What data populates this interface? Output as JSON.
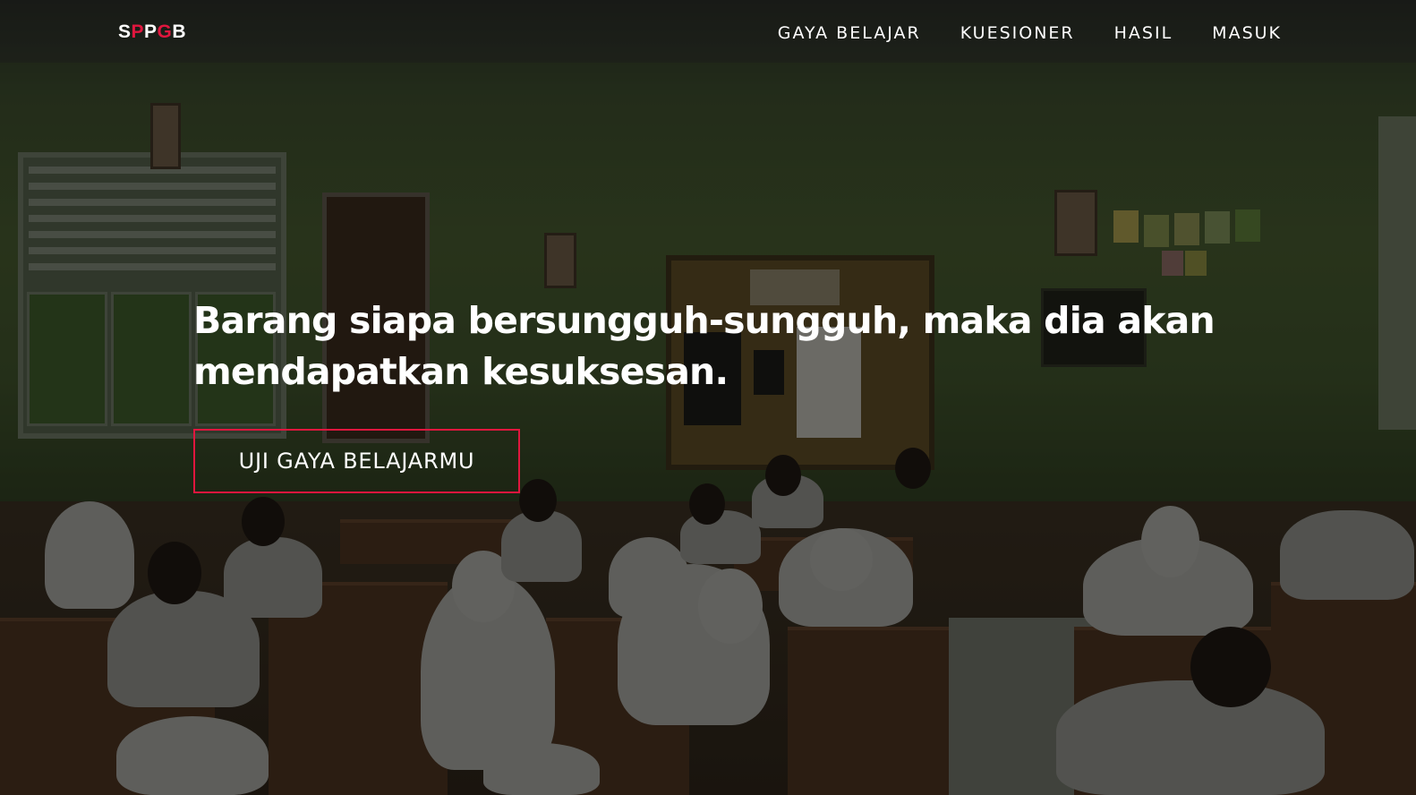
{
  "brand": {
    "letters": [
      "S",
      "P",
      "P",
      "G",
      "B"
    ]
  },
  "nav": {
    "items": [
      {
        "label": "GAYA BELAJAR"
      },
      {
        "label": "KUESIONER"
      },
      {
        "label": "HASIL"
      },
      {
        "label": "MASUK"
      }
    ]
  },
  "hero": {
    "headline": "Barang siapa bersungguh-sungguh, maka dia akan mendapatkan kesuksesan.",
    "cta_label": "UJI GAYA BELAJARMU",
    "background": "classroom-photo"
  },
  "colors": {
    "accent": "#e0163e",
    "text": "#ffffff"
  }
}
